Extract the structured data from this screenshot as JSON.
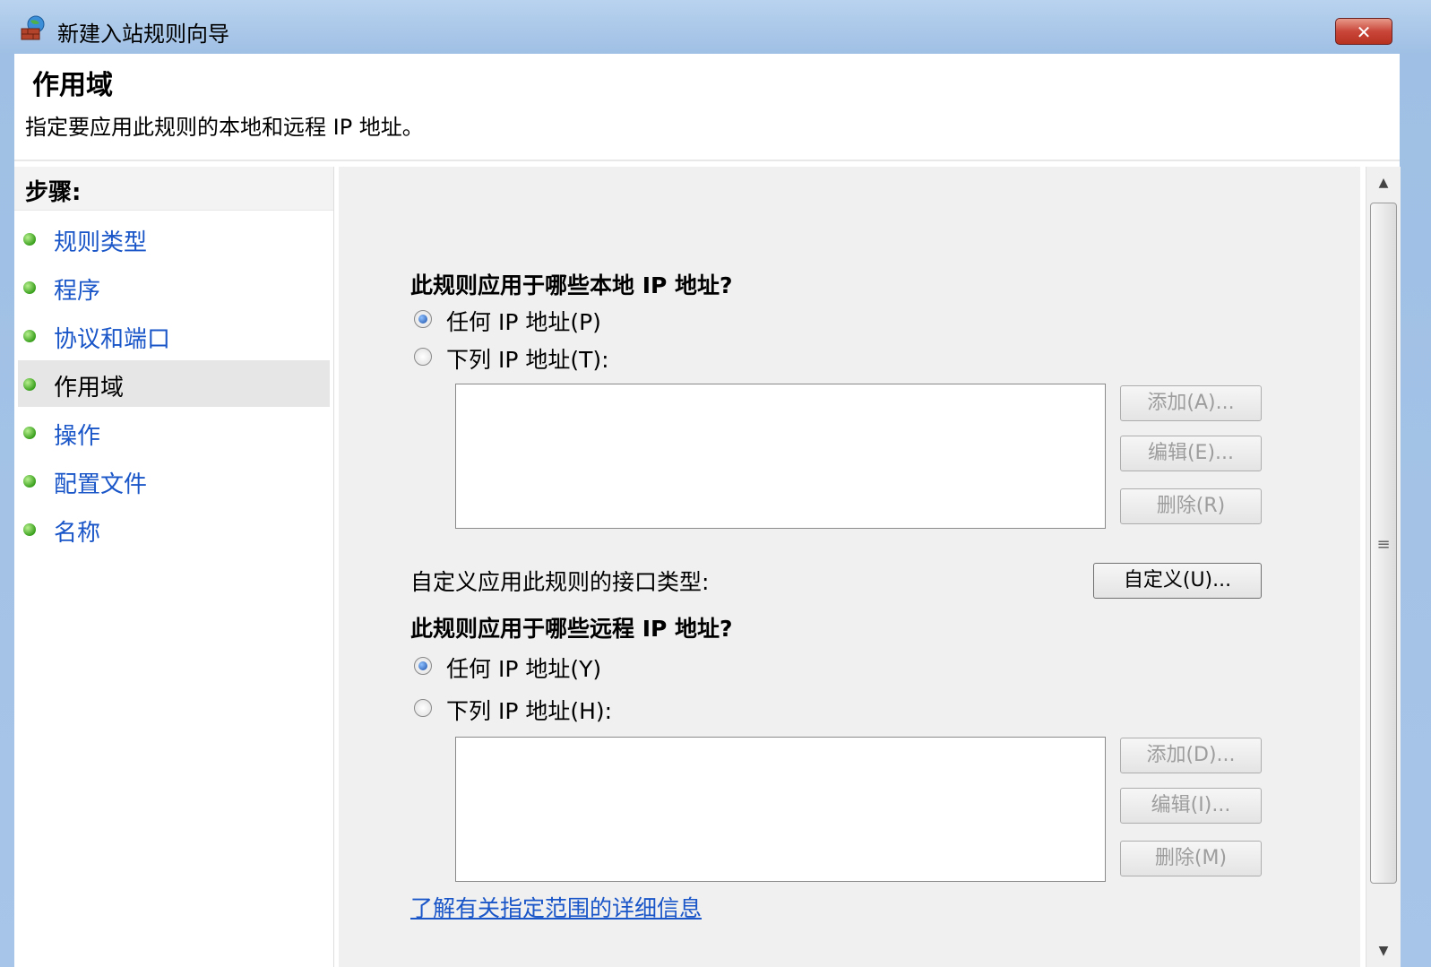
{
  "window": {
    "title": "新建入站规则向导",
    "close_glyph": "✕"
  },
  "header": {
    "title": "作用域",
    "description": "指定要应用此规则的本地和远程 IP 地址。"
  },
  "steps": {
    "heading": "步骤:",
    "items": [
      {
        "label": "规则类型",
        "active": false
      },
      {
        "label": "程序",
        "active": false
      },
      {
        "label": "协议和端口",
        "active": false
      },
      {
        "label": "作用域",
        "active": true
      },
      {
        "label": "操作",
        "active": false
      },
      {
        "label": "配置文件",
        "active": false
      },
      {
        "label": "名称",
        "active": false
      }
    ]
  },
  "local": {
    "question": "此规则应用于哪些本地 IP 地址?",
    "any_label": "任何 IP 地址(P)",
    "list_label": "下列 IP 地址(T):",
    "any_selected": true,
    "add": "添加(A)...",
    "edit": "编辑(E)...",
    "remove": "删除(R)"
  },
  "interface": {
    "label": "自定义应用此规则的接口类型:",
    "button": "自定义(U)..."
  },
  "remote": {
    "question": "此规则应用于哪些远程 IP 地址?",
    "any_label": "任何 IP 地址(Y)",
    "list_label": "下列 IP 地址(H):",
    "any_selected": true,
    "add": "添加(D)...",
    "edit": "编辑(I)...",
    "remove": "删除(M)"
  },
  "learn_more_link": "了解有关指定范围的详细信息"
}
